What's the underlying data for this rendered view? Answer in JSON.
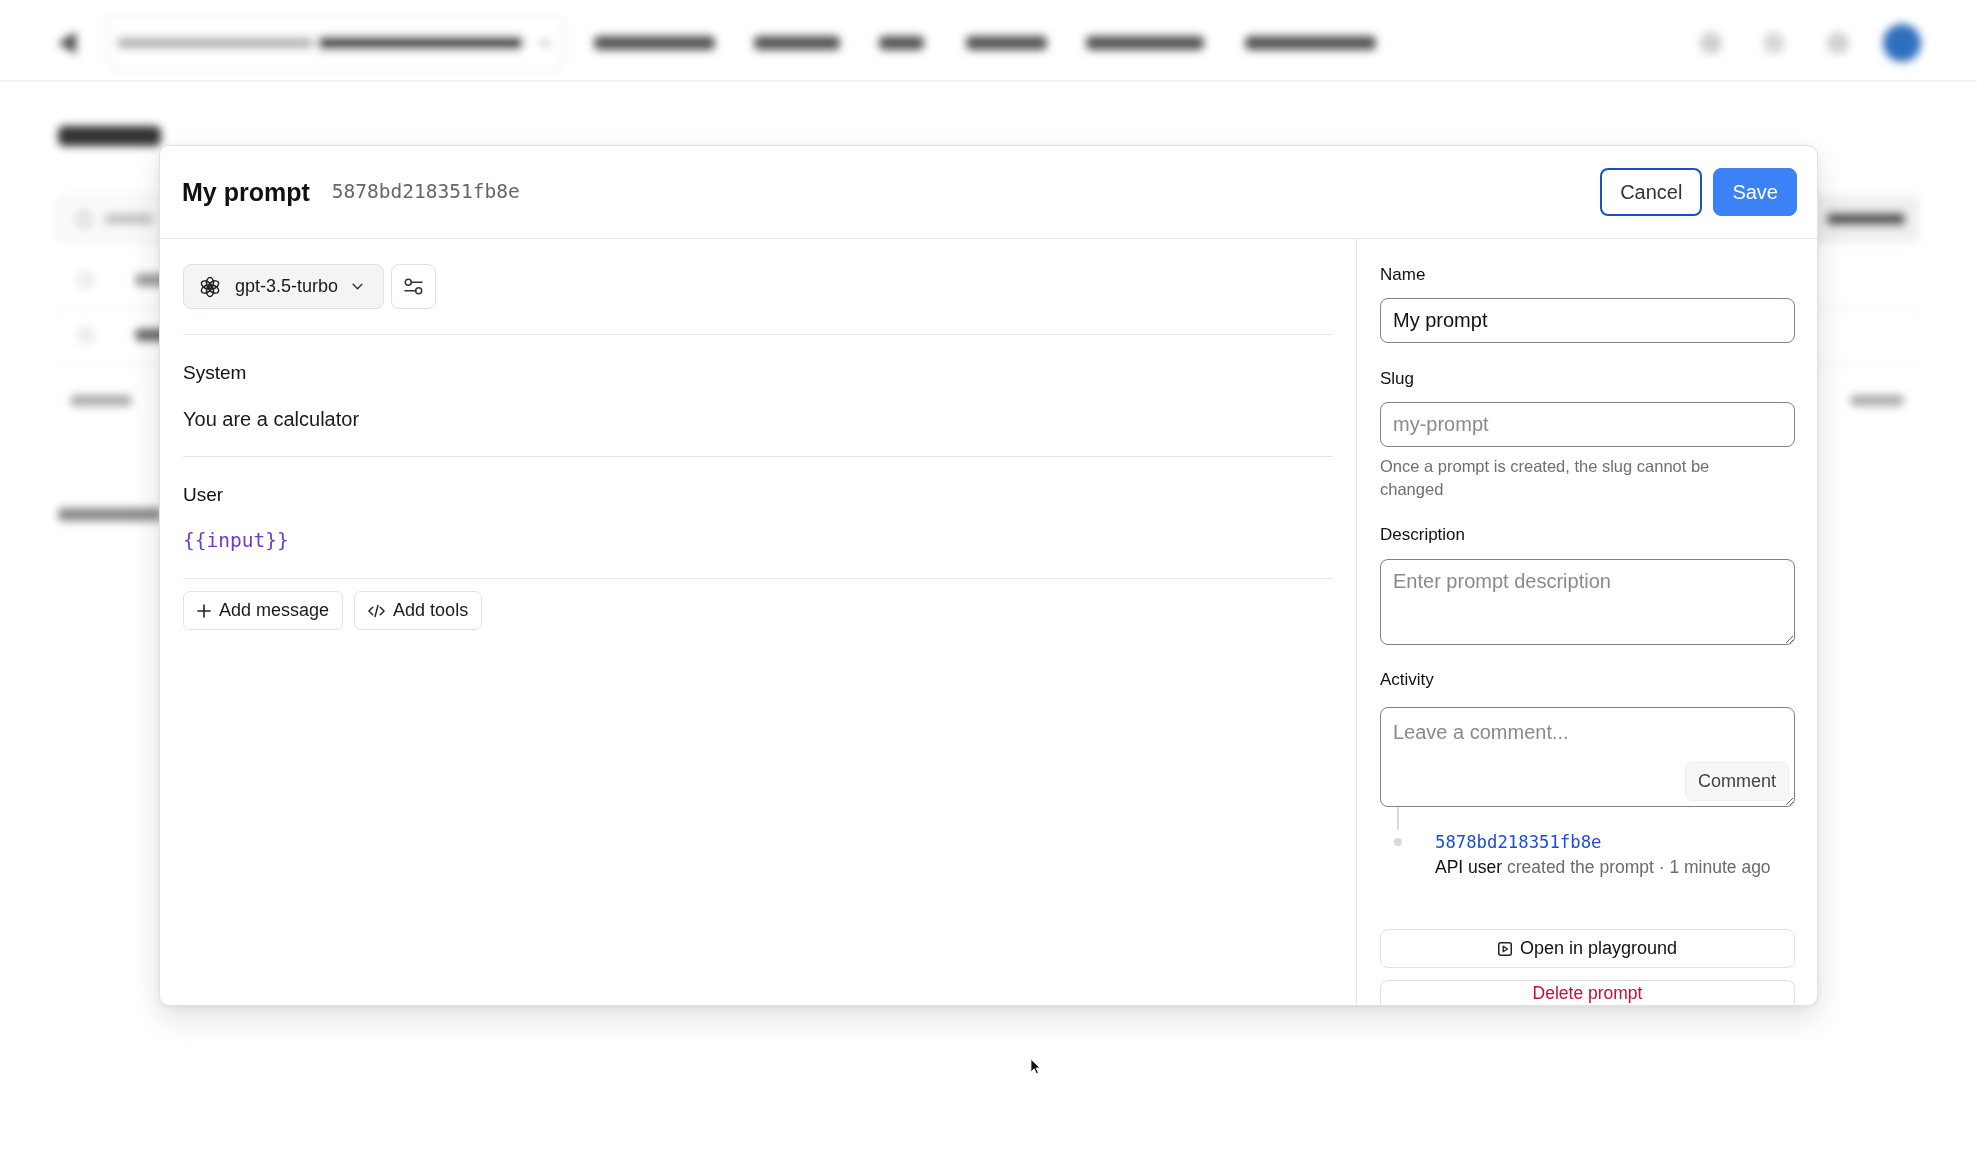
{
  "modal": {
    "title": "My prompt",
    "id": "5878bd218351fb8e",
    "buttons": [
      {
        "label": "Cancel",
        "kind": "secondary",
        "focused": true
      },
      {
        "label": "Save",
        "kind": "primary",
        "focused": false
      }
    ]
  },
  "editor": {
    "model": "gpt-3.5-turbo",
    "messages": [
      {
        "role": "System",
        "kind": "text",
        "content": "You are a calculator"
      },
      {
        "role": "User",
        "kind": "template",
        "content": "{{input}}"
      }
    ],
    "actions": [
      "Add message",
      "Add tools"
    ]
  },
  "details": {
    "fields": [
      {
        "label": "Name",
        "kind": "input",
        "value": "My prompt"
      },
      {
        "label": "Slug",
        "kind": "input",
        "placeholder": "my-prompt",
        "help": "Once a prompt is created, the slug cannot be changed"
      },
      {
        "label": "Description",
        "kind": "textarea",
        "placeholder": "Enter prompt description"
      }
    ],
    "activity": {
      "label": "Activity",
      "placeholder": "Leave a comment...",
      "button": "Comment",
      "events": [
        {
          "ref": "5878bd218351fb8e",
          "actor": "API user",
          "action": "created the prompt · 1 minute ago"
        }
      ]
    },
    "buttons": [
      {
        "label": "Open in playground",
        "kind": "default"
      },
      {
        "label": "Delete prompt",
        "kind": "danger"
      }
    ]
  }
}
